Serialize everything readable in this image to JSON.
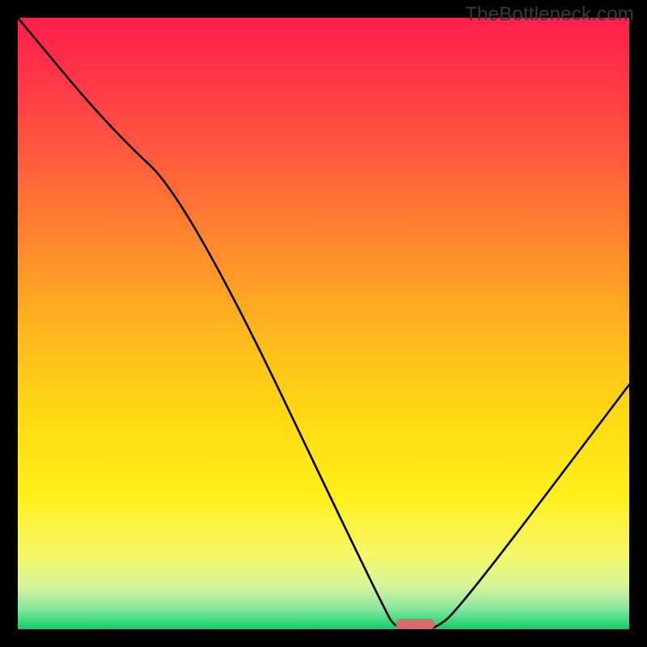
{
  "watermark": "TheBottleneck.com",
  "chart_data": {
    "type": "line",
    "title": "",
    "xlabel": "",
    "ylabel": "",
    "xlim": [
      0,
      100
    ],
    "ylim": [
      0,
      100
    ],
    "grid": false,
    "series": [
      {
        "name": "bottleneck-curve",
        "x": [
          0,
          15,
          28,
          60,
          62,
          66,
          68,
          72,
          100
        ],
        "values": [
          100,
          82,
          70,
          3,
          0,
          0,
          0,
          3,
          40
        ]
      }
    ],
    "marker": {
      "name": "optimal-point",
      "x_center": 65,
      "y": 0,
      "color": "#d86b6b"
    },
    "background_gradient": {
      "stops": [
        {
          "offset": 0.0,
          "color": "#ff1f4b"
        },
        {
          "offset": 0.06,
          "color": "#ff2c4a"
        },
        {
          "offset": 0.2,
          "color": "#ff5340"
        },
        {
          "offset": 0.35,
          "color": "#ff8230"
        },
        {
          "offset": 0.5,
          "color": "#ffb31f"
        },
        {
          "offset": 0.65,
          "color": "#ffd914"
        },
        {
          "offset": 0.78,
          "color": "#ffef1a"
        },
        {
          "offset": 0.88,
          "color": "#f5f86a"
        },
        {
          "offset": 0.93,
          "color": "#d6f49a"
        },
        {
          "offset": 0.965,
          "color": "#8be8a0"
        },
        {
          "offset": 0.99,
          "color": "#2fd87a"
        },
        {
          "offset": 1.0,
          "color": "#18c96a"
        }
      ]
    }
  }
}
